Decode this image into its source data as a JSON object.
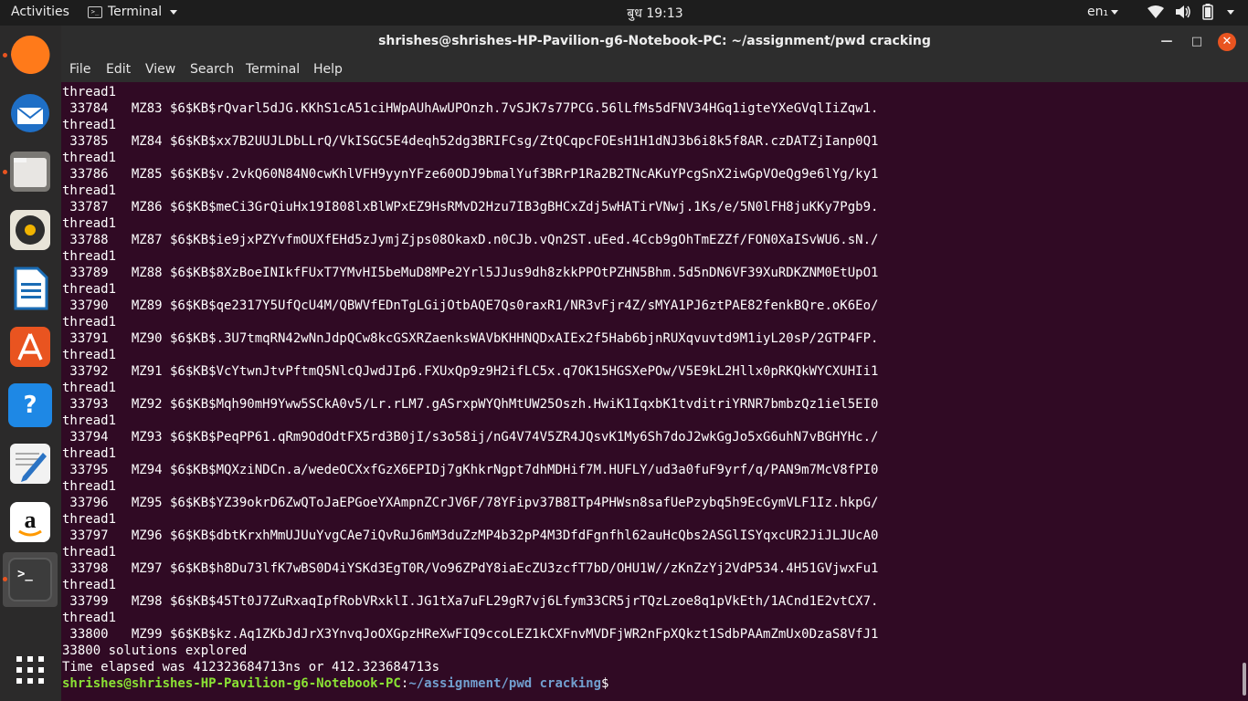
{
  "topbar": {
    "activities": "Activities",
    "app_name": "Terminal",
    "clock": "बुध 19:13",
    "language": "en₁"
  },
  "dock": {
    "items": [
      {
        "name": "firefox-icon",
        "running": true
      },
      {
        "name": "thunderbird-icon",
        "running": false
      },
      {
        "name": "files-icon",
        "running": true
      },
      {
        "name": "rhythmbox-icon",
        "running": false
      },
      {
        "name": "libreoffice-writer-icon",
        "running": false
      },
      {
        "name": "ubuntu-software-icon",
        "running": false
      },
      {
        "name": "help-icon",
        "running": false
      },
      {
        "name": "text-editor-icon",
        "running": false
      },
      {
        "name": "amazon-icon",
        "running": false
      },
      {
        "name": "terminal-icon",
        "running": true
      },
      {
        "name": "show-applications-icon",
        "running": false
      }
    ],
    "help_glyph": "?",
    "terminal_glyph": ">_"
  },
  "window": {
    "title": "shrishes@shrishes-HP-Pavilion-g6-Notebook-PC: ~/assignment/pwd cracking",
    "menu": [
      "File",
      "Edit",
      "View",
      "Search",
      "Terminal",
      "Help"
    ]
  },
  "terminal": {
    "lines": [
      "thread1",
      " 33784   MZ83 $6$KB$rQvarl5dJG.KKhS1cA51ciHWpAUhAwUPOnzh.7vSJK7s77PCG.56lLfMs5dFNV34HGq1igteYXeGVqlIiZqw1.",
      "thread1",
      " 33785   MZ84 $6$KB$xx7B2UUJLDbLLrQ/VkISGC5E4deqh52dg3BRIFCsg/ZtQCqpcFOEsH1H1dNJ3b6i8k5f8AR.czDATZjIanp0Q1",
      "thread1",
      " 33786   MZ85 $6$KB$v.2vkQ60N84N0cwKhlVFH9yynYFze60ODJ9bmalYuf3BRrP1Ra2B2TNcAKuYPcgSnX2iwGpVOeQg9e6lYg/ky1",
      "thread1",
      " 33787   MZ86 $6$KB$meCi3GrQiuHx19I808lxBlWPxEZ9HsRMvD2Hzu7IB3gBHCxZdj5wHATirVNwj.1Ks/e/5N0lFH8juKKy7Pgb9.",
      "thread1",
      " 33788   MZ87 $6$KB$ie9jxPZYvfmOUXfEHd5zJymjZjps08OkaxD.n0CJb.vQn2ST.uEed.4Ccb9gOhTmEZZf/FON0XaISvWU6.sN./",
      "thread1",
      " 33789   MZ88 $6$KB$8XzBoeINIkfFUxT7YMvHI5beMuD8MPe2Yrl5JJus9dh8zkkPPOtPZHN5Bhm.5d5nDN6VF39XuRDKZNM0EtUpO1",
      "thread1",
      " 33790   MZ89 $6$KB$qe2317Y5UfQcU4M/QBWVfEDnTgLGijOtbAQE7Qs0raxR1/NR3vFjr4Z/sMYA1PJ6ztPAE82fenkBQre.oK6Eo/",
      "thread1",
      " 33791   MZ90 $6$KB$.3U7tmqRN42wNnJdpQCw8kcGSXRZaenksWAVbKHHNQDxAIEx2f5Hab6bjnRUXqvuvtd9M1iyL20sP/2GTP4FP.",
      "thread1",
      " 33792   MZ91 $6$KB$VcYtwnJtvPftmQ5NlcQJwdJIp6.FXUxQp9z9H2ifLC5x.q7OK15HGSXePOw/V5E9kL2Hllx0pRKQkWYCXUHIi1",
      "thread1",
      " 33793   MZ92 $6$KB$Mqh90mH9Yww5SCkA0v5/Lr.rLM7.gASrxpWYQhMtUW25Oszh.HwiK1IqxbK1tvditriYRNR7bmbzQz1iel5EI0",
      "thread1",
      " 33794   MZ93 $6$KB$PeqPP61.qRm9OdOdtFX5rd3B0jI/s3o58ij/nG4V74V5ZR4JQsvK1My6Sh7doJ2wkGgJo5xG6uhN7vBGHYHc./",
      "thread1",
      " 33795   MZ94 $6$KB$MQXziNDCn.a/wedeOCXxfGzX6EPIDj7gKhkrNgpt7dhMDHif7M.HUFLY/ud3a0fuF9yrf/q/PAN9m7McV8fPI0",
      "thread1",
      " 33796   MZ95 $6$KB$YZ39okrD6ZwQToJaEPGoeYXAmpnZCrJV6F/78YFipv37B8ITp4PHWsn8safUePzybq5h9EcGymVLF1Iz.hkpG/",
      "thread1",
      " 33797   MZ96 $6$KB$dbtKrxhMmUJUuYvgCAe7iQvRuJ6mM3duZzMP4b32pP4M3DfdFgnfhl62auHcQbs2ASGlISYqxcUR2JiJLJUcA0",
      "thread1",
      " 33798   MZ97 $6$KB$h8Du73lfK7wBS0D4iYSKd3EgT0R/Vo96ZPdY8iaEcZU3zcfT7bD/OHU1W//zKnZzYj2VdP534.4H51GVjwxFu1",
      "thread1",
      " 33799   MZ98 $6$KB$45Tt0J7ZuRxaqIpfRobVRxklI.JG1tXa7uFL29gR7vj6Lfym33CR5jrTQzLzoe8q1pVkEth/1ACnd1E2vtCX7.",
      "thread1",
      " 33800   MZ99 $6$KB$kz.Aq1ZKbJdJrX3YnvqJoOXGpzHReXwFIQ9ccoLEZ1kCXFnvMVDFjWR2nFpXQkzt1SdbPAAmZmUx0DzaS8VfJ1",
      "33800 solutions explored",
      "Time elapsed was 412323684713ns or 412.323684713s"
    ],
    "prompt_user": "shrishes@shrishes-HP-Pavilion-g6-Notebook-PC",
    "prompt_sep": ":",
    "prompt_path": "~/assignment/pwd cracking",
    "prompt_symbol": "$"
  }
}
